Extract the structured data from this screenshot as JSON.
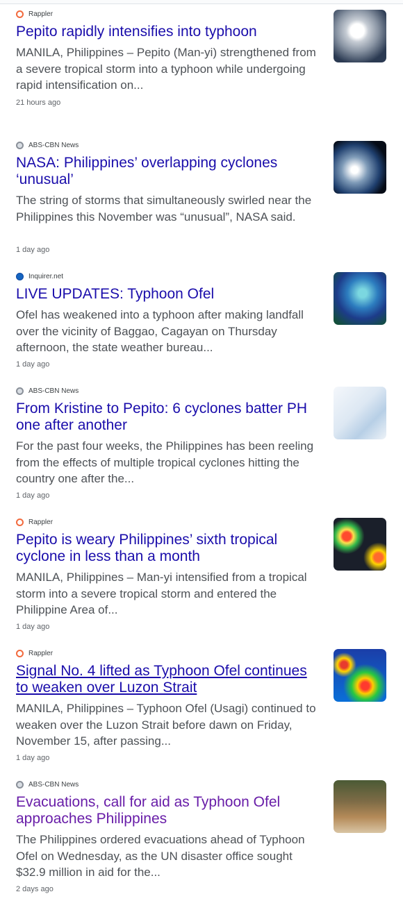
{
  "articles": [
    {
      "source": "Rappler",
      "source_icon": "rappler-icon",
      "headline": "Pepito rapidly intensifies into typhoon",
      "snippet": "MANILA, Philippines – Pepito (Man-yi) strengthened from a severe tropical storm into a typhoon while undergoing rapid intensification on...",
      "time": "21 hours ago",
      "thumbnail": "satellite-typhoon-image"
    },
    {
      "source": "ABS-CBN News",
      "source_icon": "abs-cbn-icon",
      "headline": "NASA: Philippines’ overlapping cyclones ‘unusual’",
      "snippet": "The string of storms that simultaneously swirled near the Philippines this November was “unusual”, NASA said.",
      "time": "1 day ago",
      "thumbnail": "earth-from-space-image"
    },
    {
      "source": "Inquirer.net",
      "source_icon": "inquirer-icon",
      "headline": "LIVE UPDATES: Typhoon Ofel",
      "snippet": "Ofel has weakened into a typhoon after making landfall over the vicinity of Baggao, Cagayan on Thursday afternoon, the state weather bureau...",
      "time": "1 day ago",
      "thumbnail": "weather-satellite-image"
    },
    {
      "source": "ABS-CBN News",
      "source_icon": "abs-cbn-icon",
      "headline": "From Kristine to Pepito: 6 cyclones batter PH one after another",
      "snippet": "For the past four weeks, the Philippines has been reeling from the effects of multiple tropical cyclones hitting the country one after the...",
      "time": "1 day ago",
      "thumbnail": "cyclone-track-map-image"
    },
    {
      "source": "Rappler",
      "source_icon": "rappler-icon",
      "headline": "Pepito is weary Philippines’ sixth tropical cyclone in less than a month",
      "snippet": "MANILA, Philippines – Man-yi intensified from a tropical storm into a severe tropical storm and entered the Philippine Area of...",
      "time": "1 day ago",
      "thumbnail": "infrared-satellite-image"
    },
    {
      "source": "Rappler",
      "source_icon": "rappler-icon",
      "headline": "Signal No. 4 lifted as Typhoon Ofel continues to weaken over Luzon Strait",
      "snippet": "MANILA, Philippines – Typhoon Ofel (Usagi) continued to weaken over the Luzon Strait before dawn on Friday, November 15, after passing...",
      "time": "1 day ago",
      "thumbnail": "rainfall-radar-image"
    },
    {
      "source": "ABS-CBN News",
      "source_icon": "abs-cbn-icon",
      "headline": "Evacuations, call for aid as Typhoon Ofel approaches Philippines",
      "snippet": "The Philippines ordered evacuations ahead of Typhoon Ofel on Wednesday, as the UN disaster office sought $32.9 million in aid for the...",
      "time": "2 days ago",
      "thumbnail": "flood-rescue-photo"
    }
  ],
  "colors": {
    "link": "#1a0dab",
    "visited_link": "#681da8",
    "snippet": "#4d5156",
    "meta": "#5f6368"
  }
}
